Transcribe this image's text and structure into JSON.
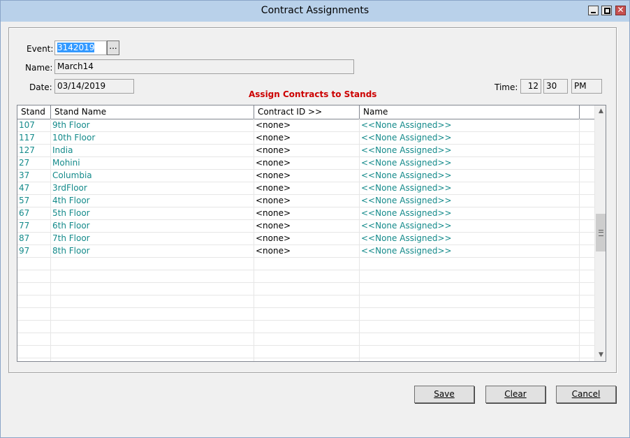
{
  "window": {
    "title": "Contract Assignments",
    "close_symbol": "✕"
  },
  "form": {
    "event_label": "Event:",
    "event_value": "3142019",
    "event_browse_label": "...",
    "name_label": "Name:",
    "name_value": "March14",
    "date_label": "Date:",
    "date_value": "03/14/2019",
    "time_label": "Time:",
    "time_hour": "12",
    "time_minute": "30",
    "time_ampm": "PM"
  },
  "section_title": "Assign Contracts to Stands",
  "grid": {
    "columns": [
      "Stand",
      "Stand Name",
      "Contract ID >>",
      "Name"
    ],
    "rows": [
      {
        "stand": "107",
        "stand_name": "9th Floor",
        "contract_id": "<none>",
        "name": "<<None Assigned>>"
      },
      {
        "stand": "117",
        "stand_name": "10th Floor",
        "contract_id": "<none>",
        "name": "<<None Assigned>>"
      },
      {
        "stand": "127",
        "stand_name": "India",
        "contract_id": "<none>",
        "name": "<<None Assigned>>"
      },
      {
        "stand": "27",
        "stand_name": "Mohini",
        "contract_id": "<none>",
        "name": "<<None Assigned>>"
      },
      {
        "stand": "37",
        "stand_name": "Columbia",
        "contract_id": "<none>",
        "name": "<<None Assigned>>"
      },
      {
        "stand": "47",
        "stand_name": "3rdFloor",
        "contract_id": "<none>",
        "name": "<<None Assigned>>"
      },
      {
        "stand": "57",
        "stand_name": "4th Floor",
        "contract_id": "<none>",
        "name": "<<None Assigned>>"
      },
      {
        "stand": "67",
        "stand_name": "5th Floor",
        "contract_id": "<none>",
        "name": "<<None Assigned>>"
      },
      {
        "stand": "77",
        "stand_name": "6th Floor",
        "contract_id": "<none>",
        "name": "<<None Assigned>>"
      },
      {
        "stand": "87",
        "stand_name": "7th Floor",
        "contract_id": "<none>",
        "name": "<<None Assigned>>"
      },
      {
        "stand": "97",
        "stand_name": "8th Floor",
        "contract_id": "<none>",
        "name": "<<None Assigned>>"
      }
    ]
  },
  "buttons": {
    "save": "Save",
    "clear": "Clear",
    "cancel": "Cancel"
  },
  "colors": {
    "accent_teal": "#138a8a",
    "section_red": "#cc0000",
    "titlebar": "#b9d1ea"
  }
}
